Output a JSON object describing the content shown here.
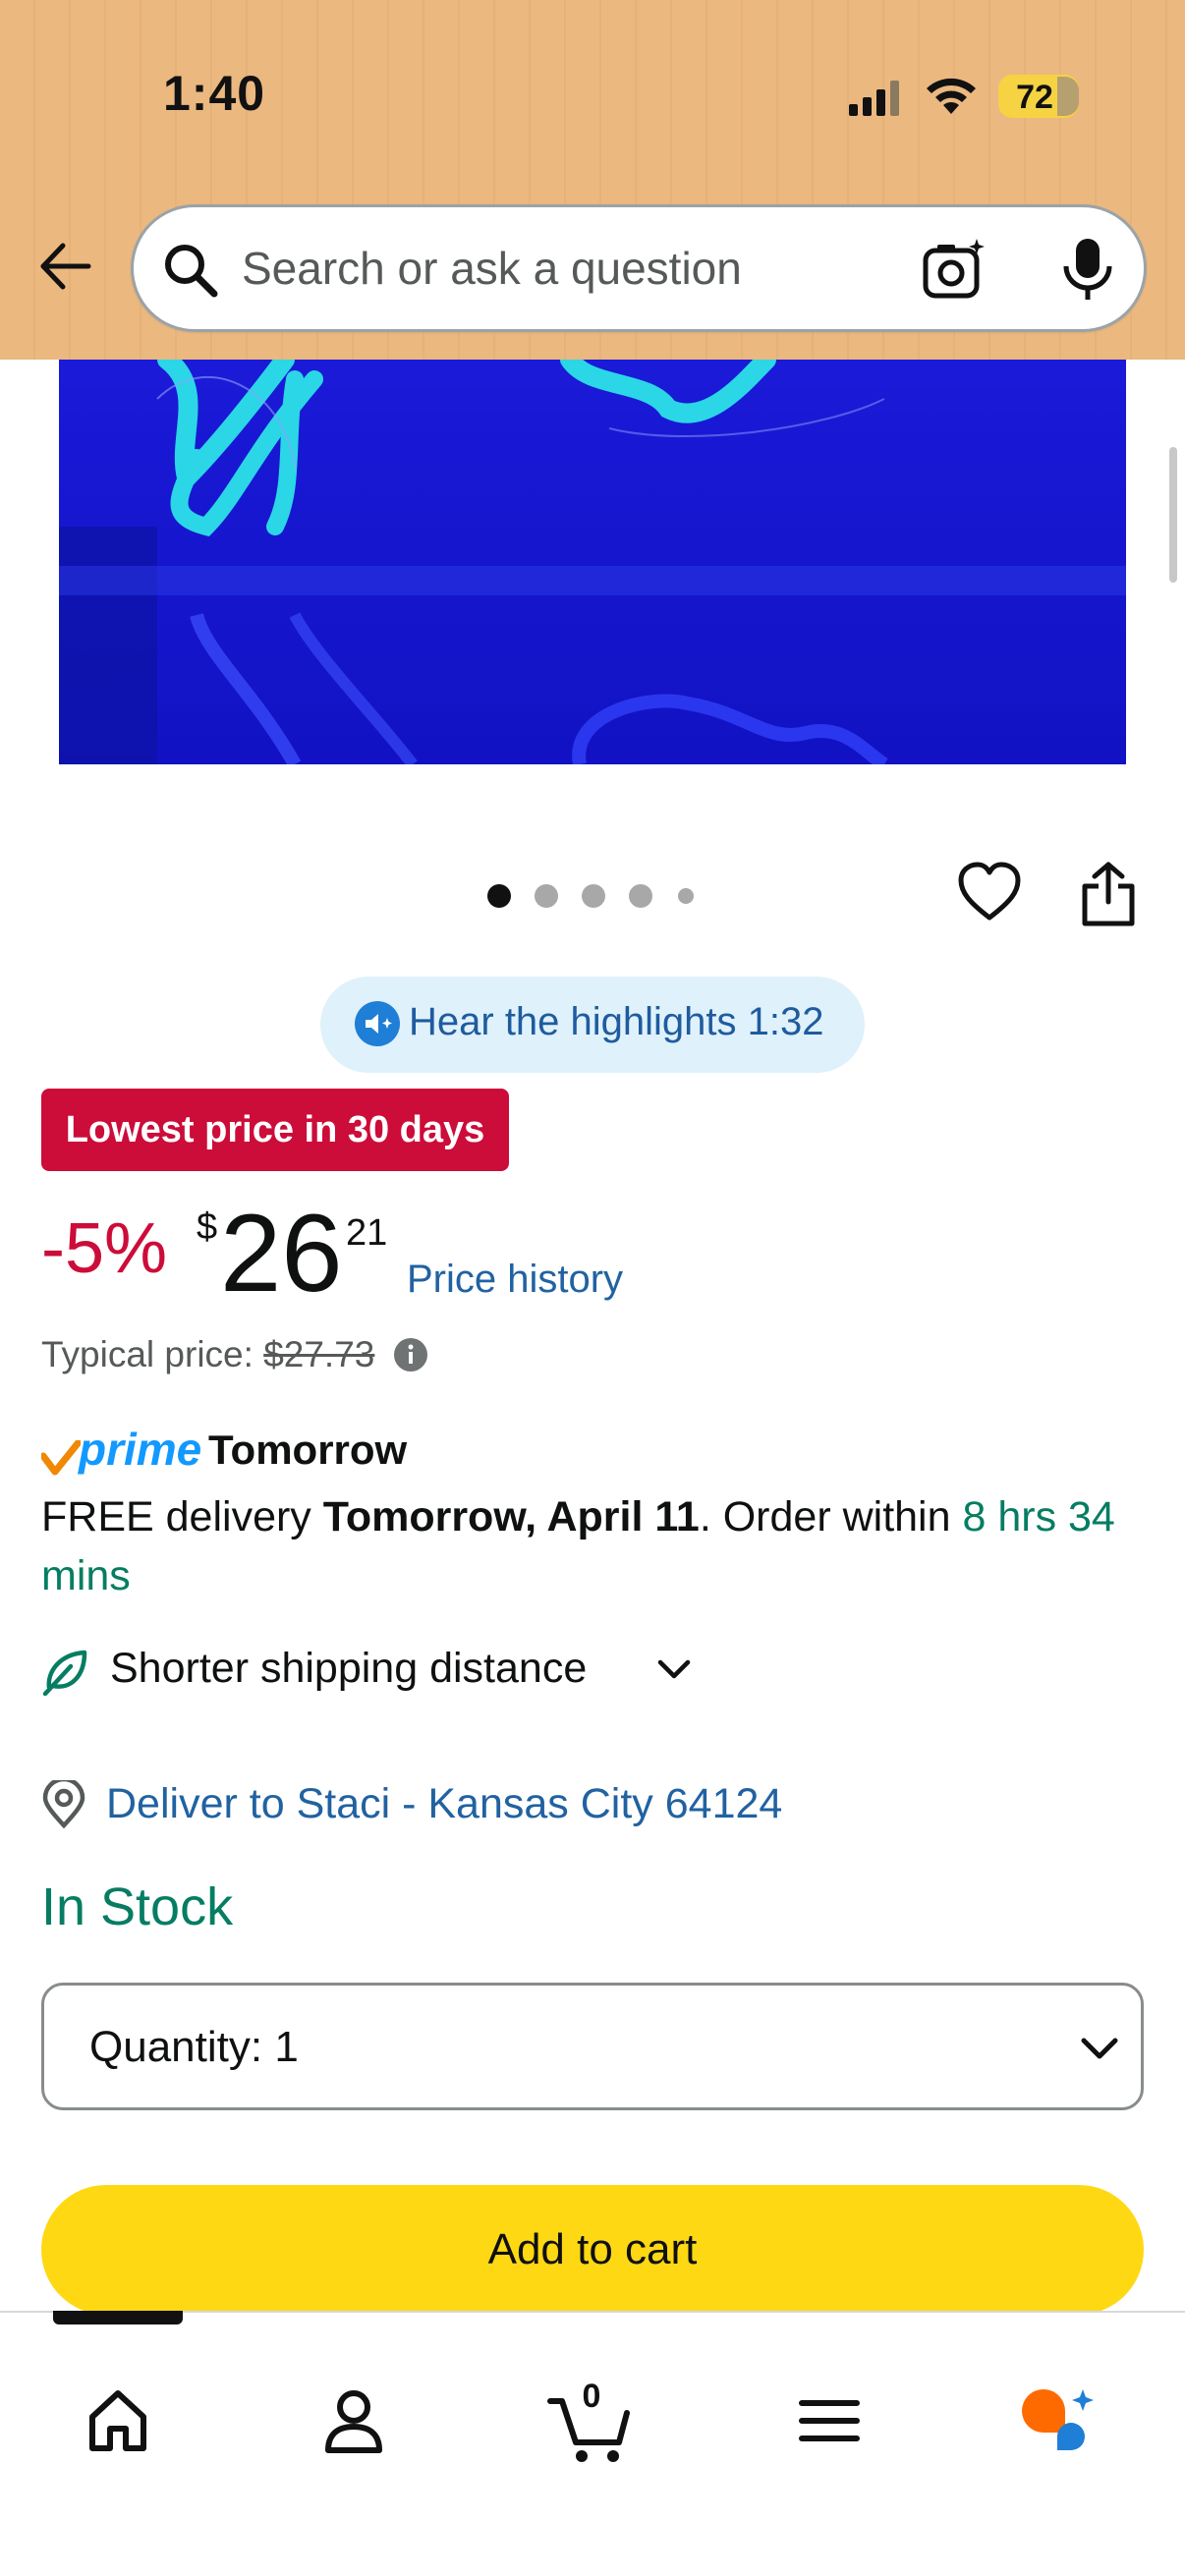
{
  "status_bar": {
    "time": "1:40",
    "battery": "72"
  },
  "search": {
    "placeholder": "Search or ask a question"
  },
  "carousel": {
    "dot_count": 5,
    "active_index": 0
  },
  "highlights": {
    "label": "Hear the highlights 1:32"
  },
  "badge": {
    "label": "Lowest price in 30 days"
  },
  "price": {
    "discount": "-5%",
    "currency": "$",
    "whole": "26",
    "fraction": "21",
    "history_label": "Price history",
    "typical_label": "Typical price:",
    "typical_value": "$27.73"
  },
  "prime": {
    "word": "prime",
    "day": "Tomorrow",
    "delivery_prefix": "FREE delivery ",
    "delivery_date": "Tomorrow, April 11",
    "delivery_mid": ". Order within ",
    "delivery_countdown": "8 hrs 34 mins"
  },
  "shipping": {
    "label": "Shorter shipping distance"
  },
  "location": {
    "label": "Deliver to Staci - Kansas City 64124"
  },
  "stock": {
    "label": "In Stock"
  },
  "quantity": {
    "label": "Quantity:",
    "value": "1"
  },
  "cart_button": {
    "label": "Add to cart"
  },
  "bottom_nav": {
    "cart_count": "0"
  },
  "colors": {
    "header_bg": "#ebb880",
    "deal_red": "#cc0c39",
    "link_blue": "#2162a1",
    "stock_green": "#067d62",
    "cart_yellow": "#ffd814",
    "prime_blue": "#1399ff"
  }
}
